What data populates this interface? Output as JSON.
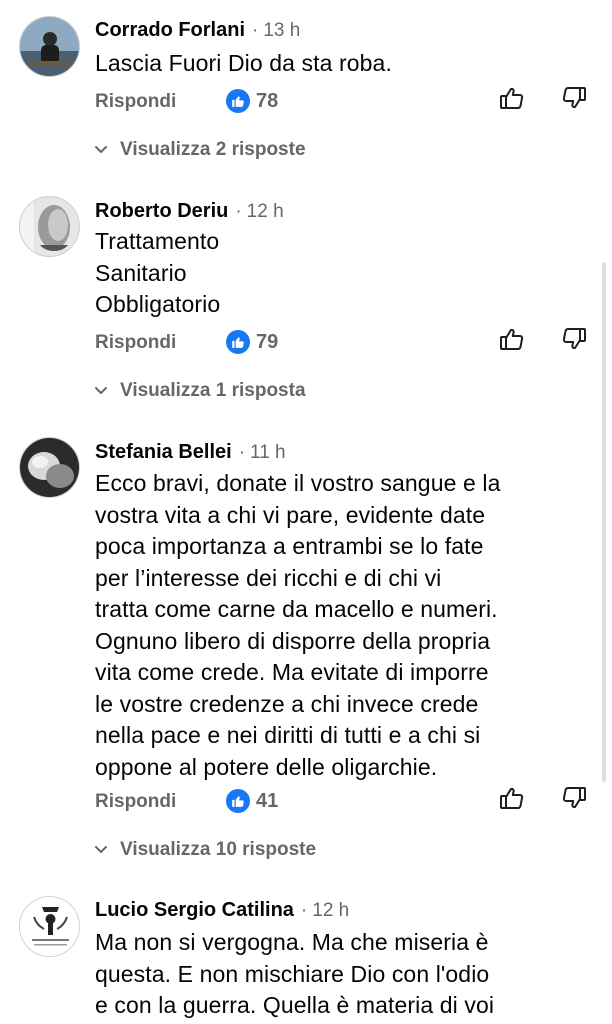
{
  "comments": [
    {
      "author": "Corrado Forlani",
      "time": "13 h",
      "text": "Lascia Fuori Dio da sta roba.",
      "reply_label": "Rispondi",
      "likes": "78",
      "view_replies": "Visualizza 2 risposte"
    },
    {
      "author": "Roberto Deriu",
      "time": "12 h",
      "text": "Trattamento\nSanitario\nObbligatorio",
      "reply_label": "Rispondi",
      "likes": "79",
      "view_replies": "Visualizza 1 risposta"
    },
    {
      "author": "Stefania Bellei",
      "time": "11 h",
      "text": "Ecco bravi, donate il vostro sangue e la\nvostra vita a chi vi pare, evidente date\npoca  importanza a entrambi se lo fate\nper l’interesse dei ricchi e di chi vi\ntratta come carne da macello e numeri.\nOgnuno libero di disporre della propria\nvita come crede. Ma evitate di imporre\nle vostre credenze a chi invece crede\nnella pace e nei diritti di tutti e a chi si\noppone al potere delle oligarchie.",
      "reply_label": "Rispondi",
      "likes": "41",
      "view_replies": "Visualizza 10 risposte"
    },
    {
      "author": "Lucio Sergio Catilina",
      "time": "12 h",
      "text": "Ma non si vergogna. Ma che miseria è\nquesta. E non mischiare Dio con l'odio\ne con la guerra. Quella è materia di voi"
    }
  ],
  "separator": "·",
  "icons": {
    "like_badge": "like-icon",
    "thumb_up": "thumb-up-icon",
    "thumb_down": "thumb-down-icon",
    "chevron": "chevron-down-icon"
  },
  "colors": {
    "like_badge": "#1877f2",
    "secondary_text": "#65676b"
  }
}
